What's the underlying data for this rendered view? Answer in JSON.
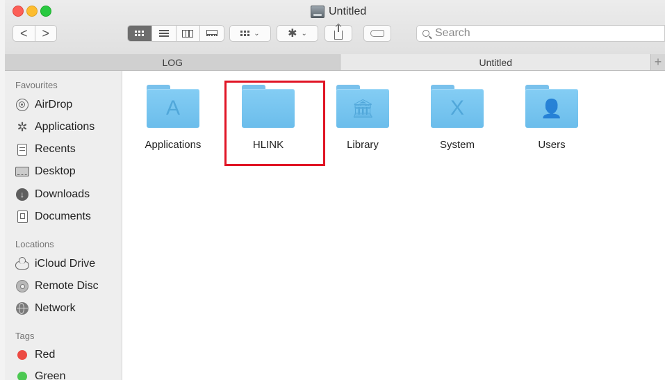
{
  "window": {
    "title": "Untitled",
    "title_icon": "disk-icon"
  },
  "toolbar": {
    "back_label": "<",
    "forward_label": ">",
    "search_placeholder": "Search",
    "view_modes": [
      "icon",
      "list",
      "column",
      "gallery"
    ],
    "active_view": "icon"
  },
  "tabs": [
    {
      "label": "LOG",
      "active": false
    },
    {
      "label": "Untitled",
      "active": true
    }
  ],
  "sidebar": {
    "favourites_header": "Favourites",
    "favourites": [
      {
        "label": "AirDrop",
        "icon": "airdrop-icon"
      },
      {
        "label": "Applications",
        "icon": "applications-icon"
      },
      {
        "label": "Recents",
        "icon": "recents-icon"
      },
      {
        "label": "Desktop",
        "icon": "desktop-icon"
      },
      {
        "label": "Downloads",
        "icon": "downloads-icon"
      },
      {
        "label": "Documents",
        "icon": "documents-icon"
      }
    ],
    "locations_header": "Locations",
    "locations": [
      {
        "label": "iCloud Drive",
        "icon": "icloud-icon"
      },
      {
        "label": "Remote Disc",
        "icon": "disc-icon"
      },
      {
        "label": "Network",
        "icon": "network-icon"
      }
    ],
    "tags_header": "Tags",
    "tags": [
      {
        "label": "Red",
        "color": "#ec4a43"
      },
      {
        "label": "Green",
        "color": "#4cc852"
      }
    ]
  },
  "content": {
    "items": [
      {
        "label": "Applications",
        "glyph": "A"
      },
      {
        "label": "HLINK",
        "glyph": ""
      },
      {
        "label": "Library",
        "glyph": "🏛"
      },
      {
        "label": "System",
        "glyph": "X"
      },
      {
        "label": "Users",
        "glyph": "👤"
      }
    ],
    "highlighted": "HLINK"
  },
  "colors": {
    "folder": "#7fc8f1",
    "highlight_border": "#e01525"
  }
}
